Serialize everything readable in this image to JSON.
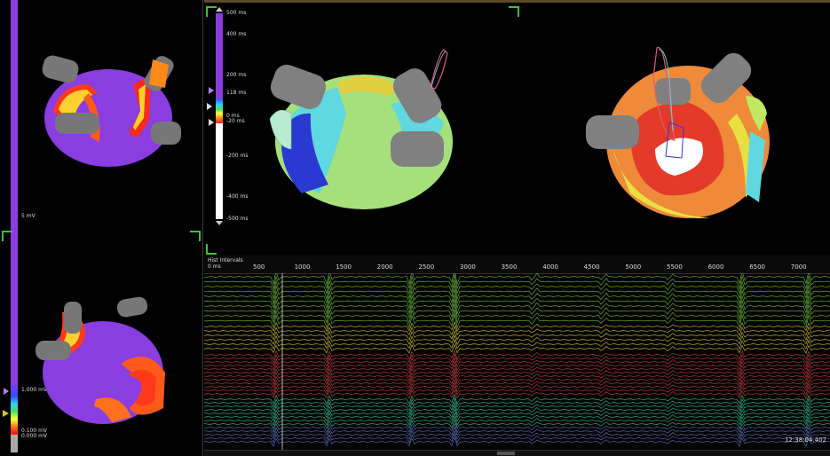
{
  "left_scale": {
    "top_label": "5 mV",
    "mid_label": "1.000 mV",
    "low_label": "0.100 mV",
    "bottom_label": "0.000 mV"
  },
  "lat_scale": {
    "labels": [
      "500 ms",
      "400 ms",
      "200 ms",
      "118 ms",
      "0 ms",
      "-20 ms",
      "-200 ms",
      "-400 ms",
      "-500 ms"
    ]
  },
  "ecg": {
    "header_label": "Hist Intervals",
    "zero_label": "0 ms",
    "ruler_ticks": [
      "500",
      "1000",
      "1500",
      "2000",
      "2500",
      "3000",
      "3500",
      "4000",
      "4500",
      "5000",
      "5500",
      "6000",
      "6500",
      "7000"
    ],
    "timestamp": "12:38:04.402"
  },
  "colors": {
    "voltage_purple": "#8a3de0",
    "frame_green": "#3fbf3f",
    "ecg_green": "#7fd84a",
    "ecg_yellow": "#f0e040",
    "ecg_red": "#e04848",
    "ecg_teal": "#3fd8a8",
    "ecg_blue": "#6f7fe0"
  },
  "icons": [
    "triangle-marker-icon",
    "chevron-up-icon",
    "chevron-down-icon"
  ]
}
